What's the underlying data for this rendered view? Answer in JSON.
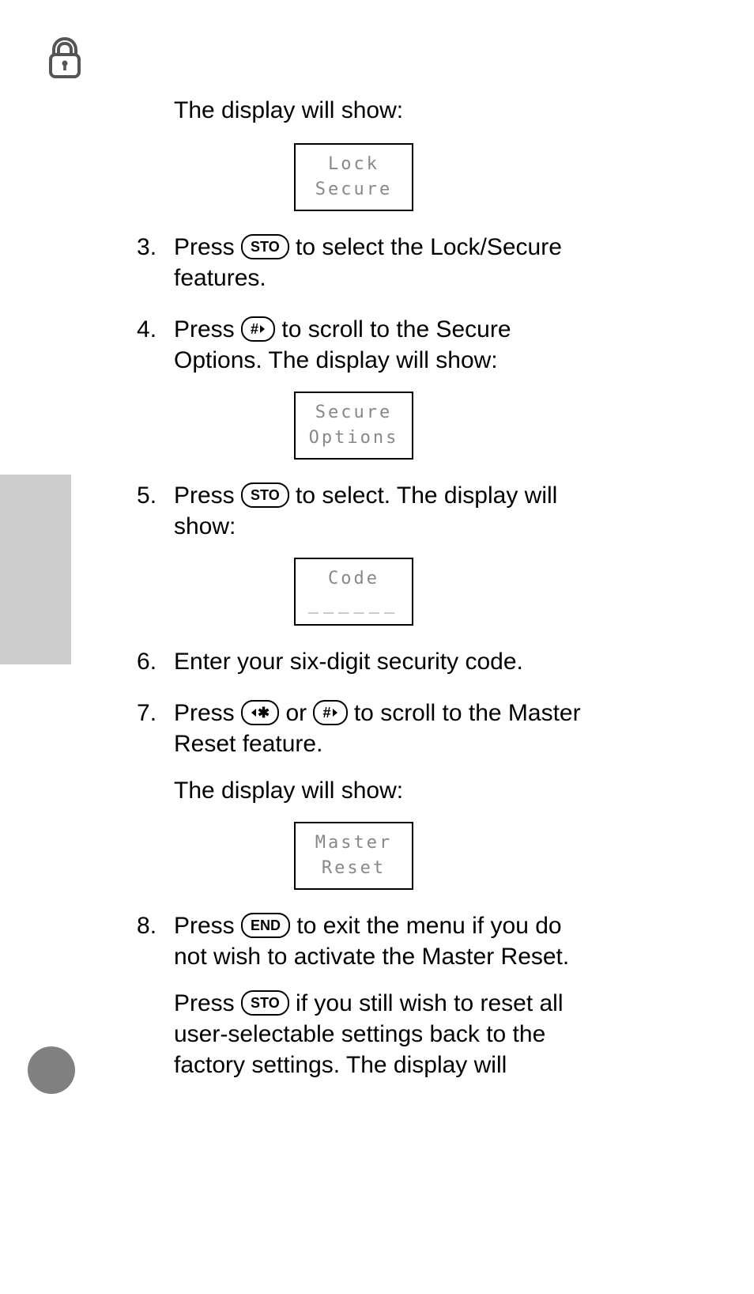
{
  "icons": {
    "lock": "lock-icon"
  },
  "keys": {
    "sto": "STO",
    "hash": "#",
    "star": "✱",
    "end": "END"
  },
  "intro": "The display will show:",
  "displays": {
    "lock_secure": {
      "line1": "Lock",
      "line2": "Secure"
    },
    "secure_options": {
      "line1": "Secure",
      "line2": "Options"
    },
    "code": {
      "line1": "Code",
      "line2": "______"
    },
    "master_reset": {
      "line1": "Master",
      "line2": "Reset"
    }
  },
  "steps": {
    "s3": {
      "before_key": "Press ",
      "after_key": " to select the Lock/Secure features."
    },
    "s4": {
      "before_key": "Press ",
      "after_key": " to scroll to the Secure Options. The display will show:"
    },
    "s5": {
      "before_key": "Press ",
      "after_key": " to select. The display will show:"
    },
    "s6": {
      "text": "Enter your six-digit security code."
    },
    "s7": {
      "t1": "Press ",
      "t2": " or ",
      "t3": " to scroll to the Master Reset feature.",
      "t4": "The display will show:"
    },
    "s8": {
      "p1a": "Press ",
      "p1b": " to exit the menu if you do not wish to activate the Master Reset.",
      "p2a": "Press ",
      "p2b": " if you still wish to reset all user-selectable settings back to the factory settings. The display will"
    }
  }
}
